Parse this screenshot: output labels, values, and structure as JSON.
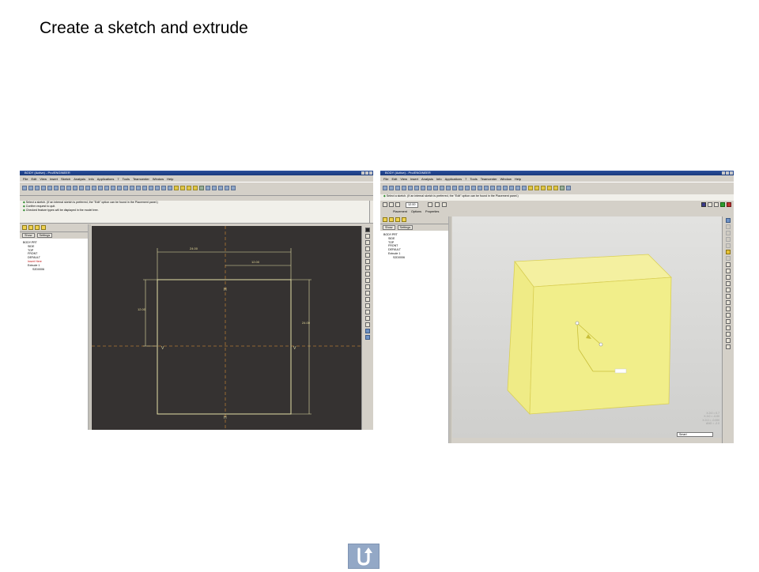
{
  "slide": {
    "title": "Create a sketch and extrude"
  },
  "left_window": {
    "title": "BODY (Active) - Pro/ENGINEER",
    "menu": [
      "File",
      "Edit",
      "View",
      "Insert",
      "Sketch",
      "Analysis",
      "Info",
      "Applications",
      "7",
      "Tools",
      "Teamcenter",
      "Window",
      "Help"
    ],
    "messages": [
      "Select a sketch. (If an internal sketch is preferred, the \"Edit\" option can be found in the Placement panel.)",
      "Confirm request to quit.",
      "Checked feature types will be displayed in the model tree."
    ],
    "tree_buttons": [
      "Show",
      "Settings"
    ],
    "tree_items": [
      "BODY.PRT",
      "SIDE",
      "TOP",
      "FRONT",
      "DEFAULT",
      "Insert Here",
      "Extrude 1",
      "S2D0006"
    ],
    "dimensions": {
      "top_width": "24.00",
      "half_width": "12.00",
      "left_height": "12.00",
      "right_height": "24.00"
    }
  },
  "right_window": {
    "title": "BODY (Active) - Pro/ENGINEER",
    "menu": [
      "File",
      "Edit",
      "View",
      "Insert",
      "Analysis",
      "Info",
      "Applications",
      "7",
      "Tools",
      "Teamcenter",
      "Window",
      "Help"
    ],
    "messages": [
      "Select a sketch. (If an internal sketch is preferred, the \"Edit\" option can be found in the Placement panel.)"
    ],
    "dashboard_tabs": [
      "Placement",
      "Options",
      "Properties"
    ],
    "depth_value": "12.00",
    "tree_buttons": [
      "Show",
      "Settings"
    ],
    "tree_items": [
      "BODY.PRT",
      "SIDE",
      "TOP",
      "FRONT",
      "DEFAULT",
      "Extrude 1",
      "S2D0006"
    ],
    "readout": [
      "X-0.0 = 0.7",
      "X-0.0 = -0.00",
      "X-0.0 = -0.000",
      "ANG = -2.0"
    ],
    "filter_select": "Smart"
  },
  "colors": {
    "sketch_bg": "#353231",
    "sketch_line": "#e5e0a8",
    "centerline": "#b07733",
    "model_bg": "#d8d8d6",
    "solid_yellow": "#f1ee8a"
  },
  "icons": {
    "nav_button": "return-arrow-icon"
  }
}
